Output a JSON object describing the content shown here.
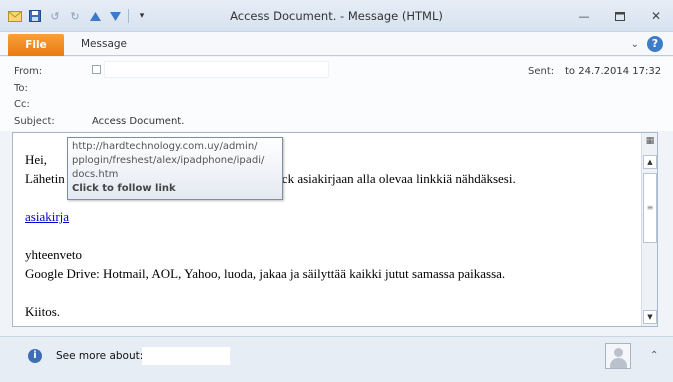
{
  "window": {
    "title": "Access Document.  -  Message (HTML)"
  },
  "quick_access": {
    "icons": [
      "envelope-icon",
      "save-icon",
      "undo-icon",
      "redo-icon",
      "up-arrow-icon",
      "down-arrow-icon",
      "customize-icon"
    ]
  },
  "ribbon": {
    "file_tab": "File",
    "message_tab": "Message"
  },
  "header": {
    "from_label": "From:",
    "to_label": "To:",
    "cc_label": "Cc:",
    "subject_label": "Subject:",
    "subject_value": "Access Document.",
    "sent_label": "Sent:",
    "sent_value": "to 24.7.2014 17:32"
  },
  "message": {
    "greeting": "Hei,",
    "line1_start": "Lähetin",
    "line1_end": "gle Docs.click asiakirjaan alla olevaa linkkiä nähdäksesi.",
    "link_text": "asiakirja ",
    "closing_title": "yhteenveto",
    "closing_text": "Google Drive: Hotmail, AOL, Yahoo, luoda, jakaa ja säilyttää kaikki jutut samassa paikassa.",
    "thanks": "Kiitos."
  },
  "tooltip": {
    "url_line1": "http://hardtechnology.com.uy/admin/",
    "url_line2": "pplogin/freshest/alex/ipadphone/ipadi/",
    "url_line3": "docs.htm",
    "follow": "Click to follow link"
  },
  "footer": {
    "see_more": "See more about:"
  }
}
